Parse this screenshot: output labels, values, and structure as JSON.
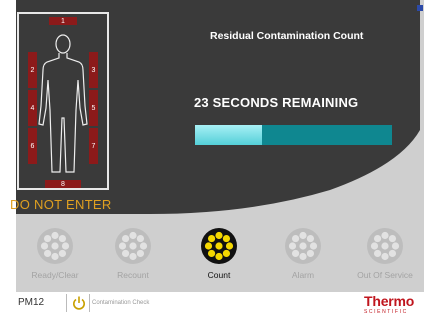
{
  "panel": {
    "title": "Residual Contamination Count",
    "remaining_text": "23 SECONDS REMAINING",
    "progress": 0.34,
    "warning": "DO NOT  ENTER"
  },
  "zones": [
    "1",
    "2",
    "3",
    "4",
    "5",
    "6",
    "7",
    "8"
  ],
  "statuses": [
    {
      "label": "Ready/Clear",
      "active": false
    },
    {
      "label": "Recount",
      "active": false
    },
    {
      "label": "Count",
      "active": true
    },
    {
      "label": "Alarm",
      "active": false
    },
    {
      "label": "Out Of Service",
      "active": false
    }
  ],
  "footer": {
    "monitor_id": "PM12",
    "mode": "Contamination Check"
  },
  "brand": {
    "name": "Thermo",
    "sub": "SCIENTIFIC"
  },
  "colors": {
    "accent_yellow": "#f5d800",
    "progress_bg": "#0f8790",
    "zone_red": "#8c1a1a",
    "warning": "#e0a020"
  }
}
